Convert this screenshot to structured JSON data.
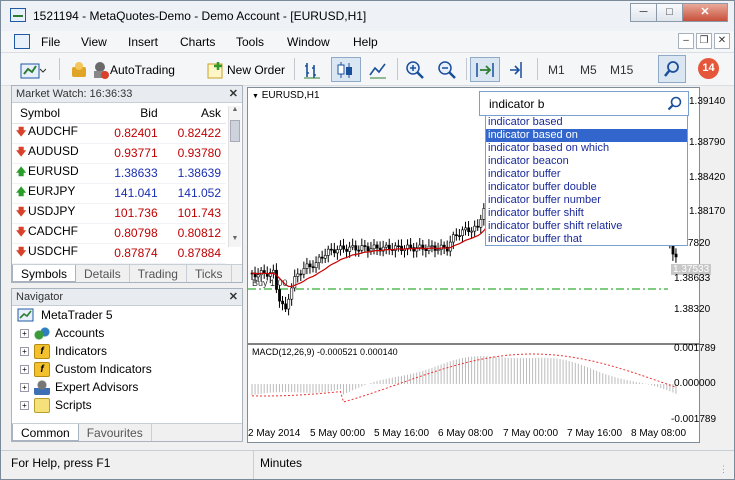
{
  "window": {
    "title": "1521194 - MetaQuotes-Demo - Demo Account - [EURUSD,H1]"
  },
  "menu": [
    "File",
    "View",
    "Insert",
    "Charts",
    "Tools",
    "Window",
    "Help"
  ],
  "toolbar": {
    "autotrading": "AutoTrading",
    "new_order": "New Order",
    "timeframes": [
      "M1",
      "M5",
      "M15"
    ],
    "notifications": "14"
  },
  "market_watch": {
    "title": "Market Watch: 16:36:33",
    "headers": [
      "Symbol",
      "Bid",
      "Ask"
    ],
    "rows": [
      {
        "symbol": "AUDCHF",
        "bid": "0.82401",
        "ask": "0.82422",
        "dir": "down"
      },
      {
        "symbol": "AUDUSD",
        "bid": "0.93771",
        "ask": "0.93780",
        "dir": "down"
      },
      {
        "symbol": "EURUSD",
        "bid": "1.38633",
        "ask": "1.38639",
        "dir": "up"
      },
      {
        "symbol": "EURJPY",
        "bid": "141.041",
        "ask": "141.052",
        "dir": "up"
      },
      {
        "symbol": "USDJPY",
        "bid": "101.736",
        "ask": "101.743",
        "dir": "down"
      },
      {
        "symbol": "CADCHF",
        "bid": "0.80798",
        "ask": "0.80812",
        "dir": "down"
      },
      {
        "symbol": "USDCHF",
        "bid": "0.87874",
        "ask": "0.87884",
        "dir": "down"
      }
    ],
    "tabs": [
      "Symbols",
      "Details",
      "Trading",
      "Ticks"
    ]
  },
  "navigator": {
    "title": "Navigator",
    "root": "MetaTrader 5",
    "items": [
      "Accounts",
      "Indicators",
      "Custom Indicators",
      "Expert Advisors",
      "Scripts"
    ],
    "tabs": [
      "Common",
      "Favourites"
    ]
  },
  "chart": {
    "symbol_label": "EURUSD,H1",
    "buy_label": "Buy 1.00",
    "macd_label": "MACD(12,26,9) -0.000521 0.000140",
    "price_labels": [
      "1.39140",
      "1.38790",
      "1.38420",
      "1.38170",
      "1.37820",
      "1.37533",
      "1.38633",
      "1.38320"
    ],
    "macd_labels": [
      "0.001789",
      "0.000000",
      "-0.001789"
    ],
    "time_labels": [
      "2 May 2014",
      "5 May 00:00",
      "5 May 16:00",
      "6 May 08:00",
      "7 May 00:00",
      "7 May 16:00",
      "8 May 08:00"
    ]
  },
  "search": {
    "query": "indicator b",
    "suggestions": [
      "indicator based",
      "indicator based on",
      "indicator based on which",
      "indicator beacon",
      "indicator buffer",
      "indicator buffer double",
      "indicator buffer number",
      "indicator buffer shift",
      "indicator buffer shift relative",
      "indicator buffer that"
    ],
    "highlighted": 1
  },
  "status": {
    "help": "For Help, press F1",
    "mode": "Minutes"
  }
}
